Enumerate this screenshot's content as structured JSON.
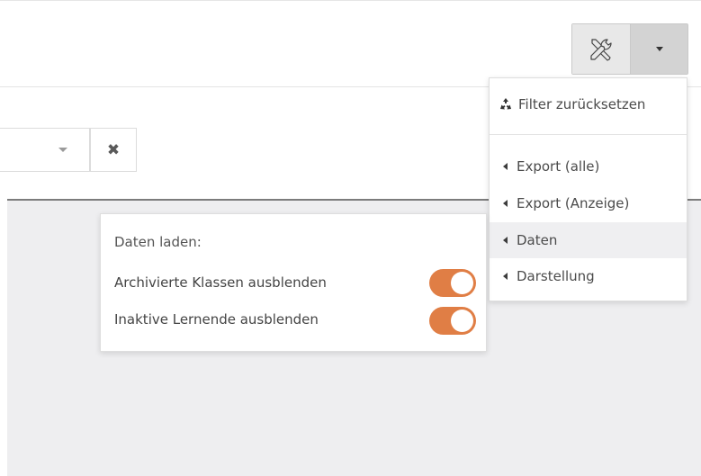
{
  "toolbar": {
    "tools_icon": "tools-icon",
    "dropdown_icon": "caret-down-icon"
  },
  "filter": {
    "clear_icon": "close-icon",
    "clear_glyph": "✖"
  },
  "menu": {
    "reset_label": "Filter zurücksetzen",
    "reset_icon": "recycle-icon",
    "items": [
      {
        "label": "Export (alle)"
      },
      {
        "label": "Export (Anzeige)"
      },
      {
        "label": "Daten",
        "active": true
      },
      {
        "label": "Darstellung"
      }
    ]
  },
  "panel": {
    "title": "Daten laden:",
    "options": [
      {
        "label": "Archivierte Klassen ausblenden",
        "on": true
      },
      {
        "label": "Inaktive Lernende ausblenden",
        "on": true
      }
    ]
  },
  "colors": {
    "toggle_on": "#e07e45",
    "active_item_bg": "#efeff1",
    "main_bg": "#eeeef0"
  }
}
